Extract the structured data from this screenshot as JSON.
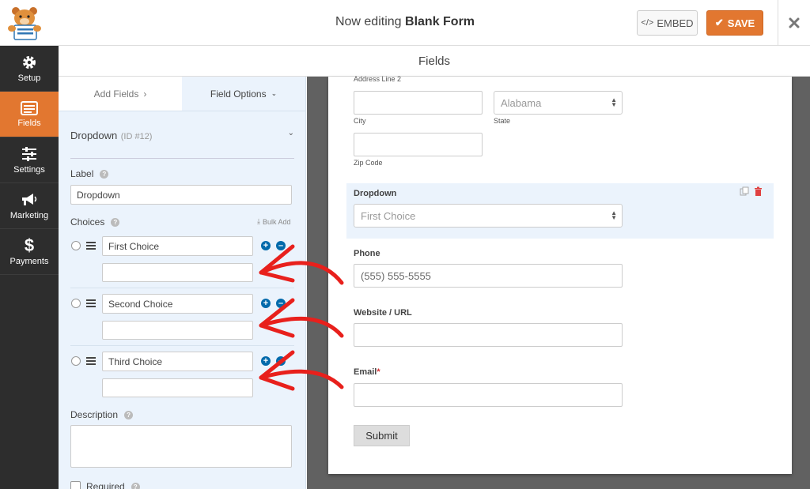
{
  "header": {
    "editing_prefix": "Now editing",
    "form_name": "Blank Form",
    "embed_label": "EMBED",
    "save_label": "SAVE",
    "accent_color": "#e27730"
  },
  "sidebar": {
    "items": [
      {
        "label": "Setup",
        "icon": "gear-icon"
      },
      {
        "label": "Fields",
        "icon": "fields-icon",
        "active": true
      },
      {
        "label": "Settings",
        "icon": "sliders-icon"
      },
      {
        "label": "Marketing",
        "icon": "megaphone-icon"
      },
      {
        "label": "Payments",
        "icon": "dollar-icon"
      }
    ]
  },
  "section_title": "Fields",
  "panel": {
    "tabs": [
      {
        "label": "Add Fields"
      },
      {
        "label": "Field Options",
        "active": true
      }
    ],
    "field_title": "Dropdown",
    "field_id": "(ID #12)",
    "label_heading": "Label",
    "label_value": "Dropdown",
    "choices_heading": "Choices",
    "bulk_add": "Bulk Add",
    "choices": [
      {
        "value": "First Choice"
      },
      {
        "value": "Second Choice"
      },
      {
        "value": "Third Choice"
      }
    ],
    "description_heading": "Description",
    "required_label": "Required"
  },
  "form": {
    "address_line2_label": "Address Line 2",
    "city_label": "City",
    "state_label": "State",
    "state_value": "Alabama",
    "zip_label": "Zip Code",
    "dropdown_label": "Dropdown",
    "dropdown_value": "First Choice",
    "phone_label": "Phone",
    "phone_placeholder": "(555) 555-5555",
    "website_label": "Website / URL",
    "email_label": "Email",
    "email_required_mark": "*",
    "submit_label": "Submit"
  },
  "annotation_color": "#e8201c"
}
